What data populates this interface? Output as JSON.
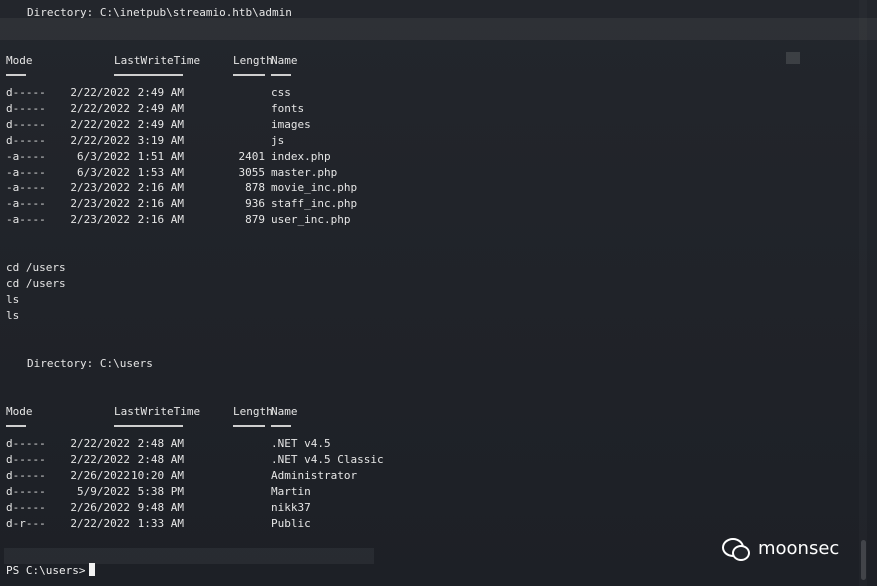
{
  "block1": {
    "directory_label": "Directory:",
    "directory_path": "C:\\inetpub\\streamio.htb\\admin",
    "headers": {
      "mode": "Mode",
      "time": "LastWriteTime",
      "length": "Length",
      "name": "Name"
    },
    "rows": [
      {
        "mode": "d-----",
        "date": "2/22/2022",
        "time": "2:49 AM",
        "length": "",
        "name": "css"
      },
      {
        "mode": "d-----",
        "date": "2/22/2022",
        "time": "2:49 AM",
        "length": "",
        "name": "fonts"
      },
      {
        "mode": "d-----",
        "date": "2/22/2022",
        "time": "2:49 AM",
        "length": "",
        "name": "images"
      },
      {
        "mode": "d-----",
        "date": "2/22/2022",
        "time": "3:19 AM",
        "length": "",
        "name": "js"
      },
      {
        "mode": "-a----",
        "date": "6/3/2022",
        "time": "1:51 AM",
        "length": "2401",
        "name": "index.php"
      },
      {
        "mode": "-a----",
        "date": "6/3/2022",
        "time": "1:53 AM",
        "length": "3055",
        "name": "master.php"
      },
      {
        "mode": "-a----",
        "date": "2/23/2022",
        "time": "2:16 AM",
        "length": "878",
        "name": "movie_inc.php"
      },
      {
        "mode": "-a----",
        "date": "2/23/2022",
        "time": "2:16 AM",
        "length": "936",
        "name": "staff_inc.php"
      },
      {
        "mode": "-a----",
        "date": "2/23/2022",
        "time": "2:16 AM",
        "length": "879",
        "name": "user_inc.php"
      }
    ]
  },
  "commands": [
    "cd /users",
    "cd /users",
    "ls",
    "ls"
  ],
  "block2": {
    "directory_label": "Directory:",
    "directory_path": "C:\\users",
    "headers": {
      "mode": "Mode",
      "time": "LastWriteTime",
      "length": "Length",
      "name": "Name"
    },
    "rows": [
      {
        "mode": "d-----",
        "date": "2/22/2022",
        "time": "2:48 AM",
        "length": "",
        "name": ".NET v4.5"
      },
      {
        "mode": "d-----",
        "date": "2/22/2022",
        "time": "2:48 AM",
        "length": "",
        "name": ".NET v4.5 Classic"
      },
      {
        "mode": "d-----",
        "date": "2/26/2022",
        "time": "10:20 AM",
        "length": "",
        "name": "Administrator"
      },
      {
        "mode": "d-----",
        "date": "5/9/2022",
        "time": "5:38 PM",
        "length": "",
        "name": "Martin"
      },
      {
        "mode": "d-----",
        "date": "2/26/2022",
        "time": "9:48 AM",
        "length": "",
        "name": "nikk37"
      },
      {
        "mode": "d-r---",
        "date": "2/22/2022",
        "time": "1:33 AM",
        "length": "",
        "name": "Public"
      }
    ]
  },
  "prompt": "PS C:\\users>",
  "watermark": {
    "text": "moonsec",
    "icon": "wechat-icon"
  },
  "colors": {
    "background": "#1f2228",
    "text": "#e6e6e6"
  }
}
